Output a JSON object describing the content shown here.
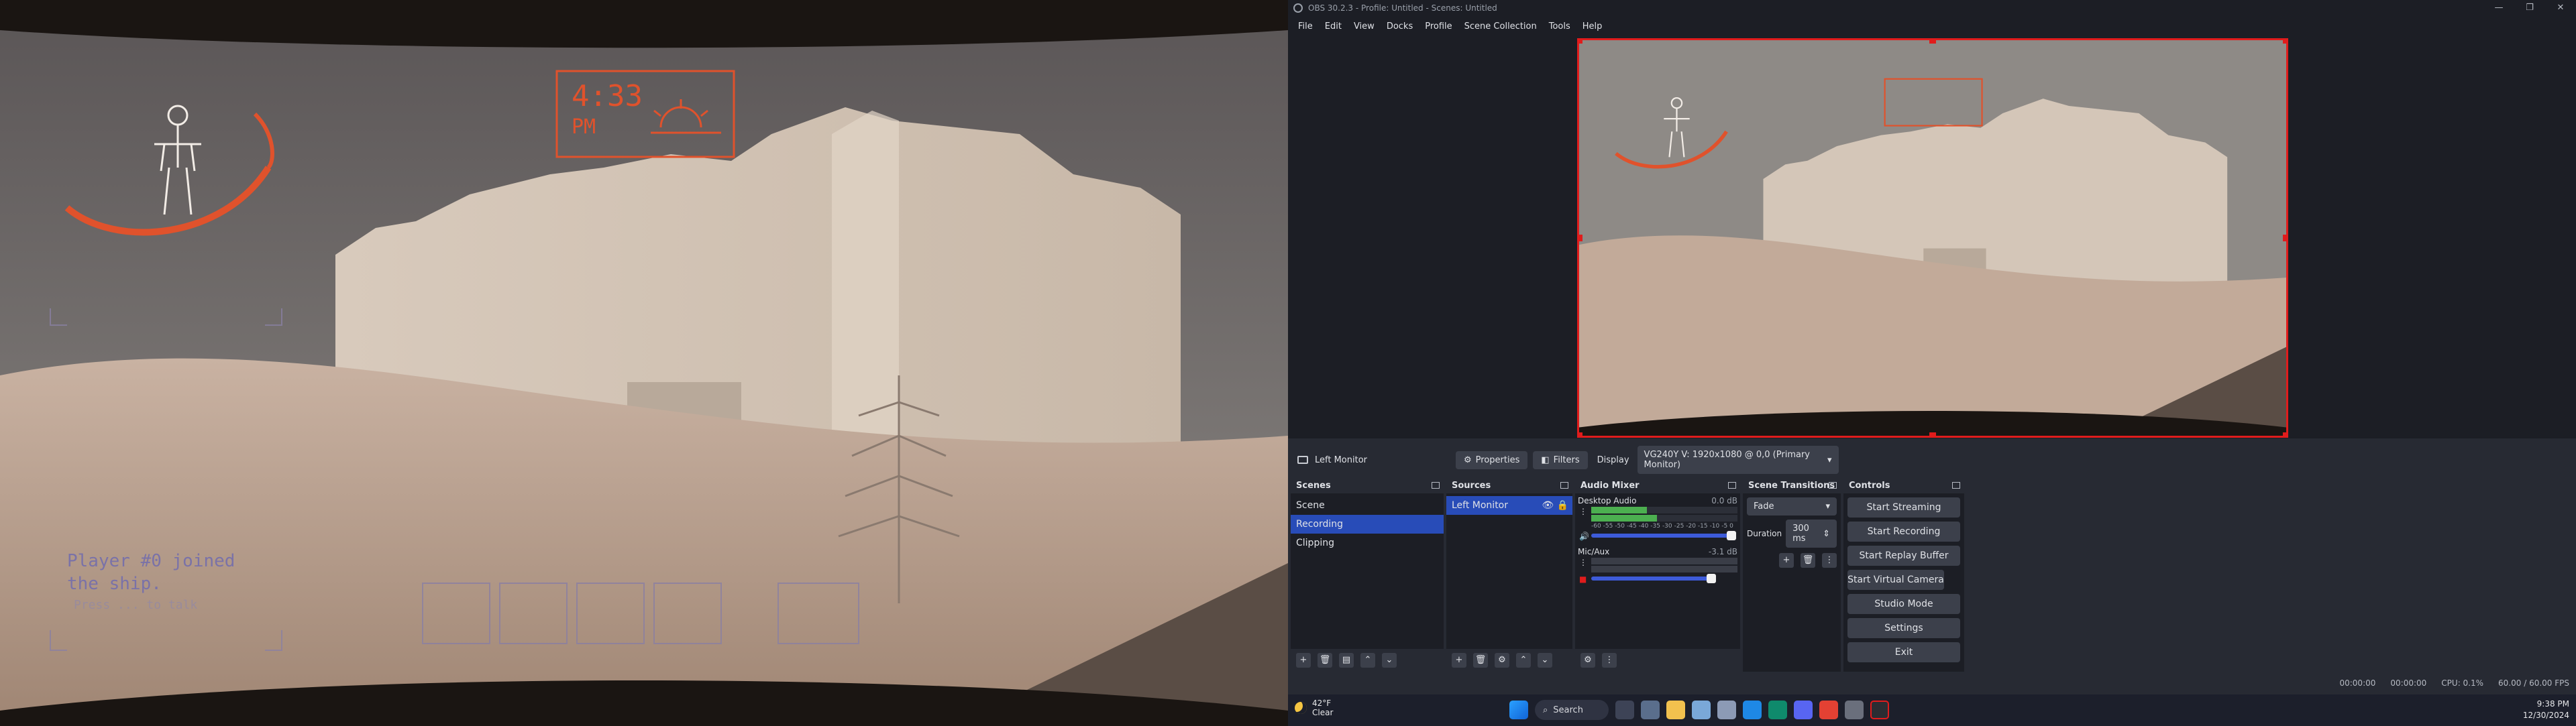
{
  "game": {
    "clock_hour_minute": "4:33",
    "clock_ampm": "PM",
    "chat_line1": "Player #0 joined",
    "chat_line2": "the ship.",
    "chat_hint": "Press ... to talk"
  },
  "obs": {
    "window_title": "OBS 30.2.3 - Profile: Untitled - Scenes: Untitled",
    "menu": [
      "File",
      "Edit",
      "View",
      "Docks",
      "Profile",
      "Scene Collection",
      "Tools",
      "Help"
    ],
    "context": {
      "source_name": "Left Monitor",
      "properties_label": "Properties",
      "filters_label": "Filters",
      "display_label": "Display",
      "display_value": "VG240Y V: 1920x1080 @ 0,0 (Primary Monitor)"
    },
    "scenes": {
      "title": "Scenes",
      "items": [
        "Scene",
        "Recording",
        "Clipping"
      ],
      "selected_index": 1
    },
    "sources": {
      "title": "Sources",
      "items": [
        "Left Monitor"
      ]
    },
    "audio_mixer": {
      "title": "Audio Mixer",
      "ticks": [
        "-60",
        "-55",
        "-50",
        "-45",
        "-40",
        "-35",
        "-30",
        "-25",
        "-20",
        "-15",
        "-10",
        "-5",
        "0"
      ],
      "channels": [
        {
          "name": "Desktop Audio",
          "db": "0.0 dB",
          "volume": 1.0
        },
        {
          "name": "Mic/Aux",
          "db": "-3.1 dB",
          "volume": 0.9
        }
      ]
    },
    "transitions": {
      "title": "Scene Transitions",
      "transition": "Fade",
      "duration_label": "Duration",
      "duration_value": "300 ms"
    },
    "controls": {
      "title": "Controls",
      "buttons": [
        "Start Streaming",
        "Start Recording",
        "Start Replay Buffer",
        "Start Virtual Camera",
        "Studio Mode",
        "Settings",
        "Exit"
      ]
    },
    "status": {
      "rec_time": "00:00:00",
      "stream_time": "00:00:00",
      "cpu": "CPU: 0.1%",
      "fps": "60.00 / 60.00 FPS"
    }
  },
  "taskbar": {
    "temperature": "42°F",
    "weather": "Clear",
    "search_placeholder": "Search",
    "time": "9:38 PM",
    "date": "12/30/2024"
  },
  "colors": {
    "obs_accent": "#284cb8",
    "hud_orange": "#e0522c",
    "selection_red": "#e01c1c"
  }
}
